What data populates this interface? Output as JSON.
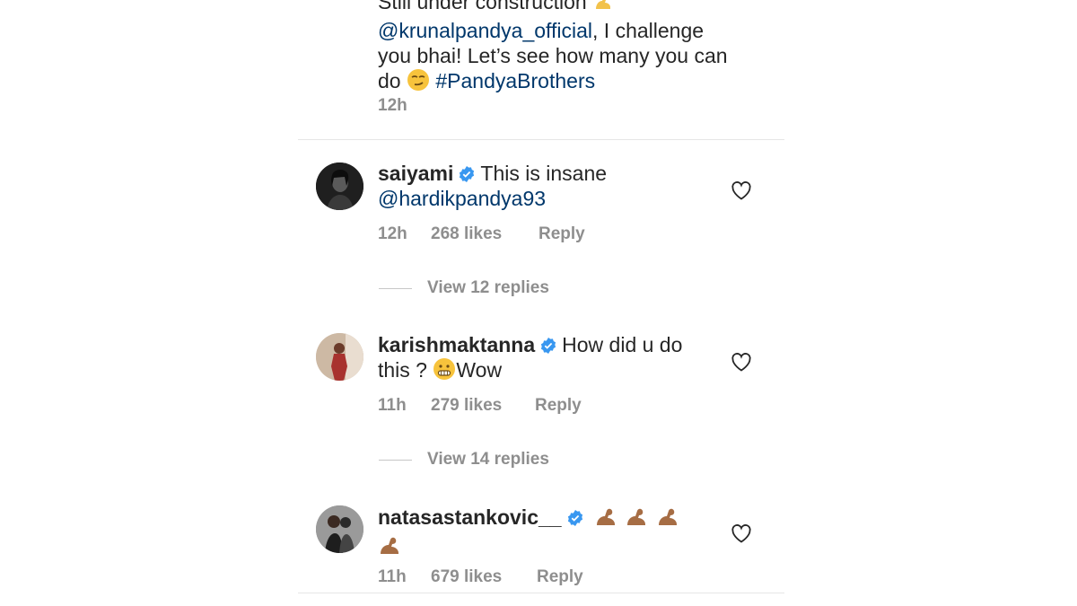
{
  "top_comment": {
    "line1_partial": "Still under construction",
    "mention": "@krunalpandya_official",
    "line2_rest": ", I challenge",
    "line3": "you bhai! Let’s see how many you can",
    "line4_prefix": "do",
    "hashtag": "#PandyaBrothers",
    "time": "12h"
  },
  "comments": [
    {
      "username": "saiyami",
      "text_line1": "This is insane",
      "mention": "@hardikpandya93",
      "time": "12h",
      "likes": "268 likes",
      "reply": "Reply",
      "view_replies": "View 12 replies"
    },
    {
      "username": "karishmaktanna",
      "text_line1": "How did u do",
      "text_line2_a": "this ?",
      "text_line2_b": "Wow",
      "time": "11h",
      "likes": "279 likes",
      "reply": "Reply",
      "view_replies": "View 14 replies"
    },
    {
      "username": "natasastankovic__",
      "time": "11h",
      "likes": "679 likes",
      "reply": "Reply"
    }
  ],
  "colors": {
    "text": "#262626",
    "mention": "#00376b",
    "meta": "#8e8e8e",
    "verified": "#3897f0",
    "emoji_flex": "#a66d44"
  },
  "icons": {
    "verified": "verified-badge-icon",
    "heart": "heart-outline-icon",
    "emoji_smirk": "smirk-emoji-icon",
    "emoji_grimace": "grimace-emoji-icon",
    "emoji_flex": "flexed-biceps-emoji-icon"
  }
}
